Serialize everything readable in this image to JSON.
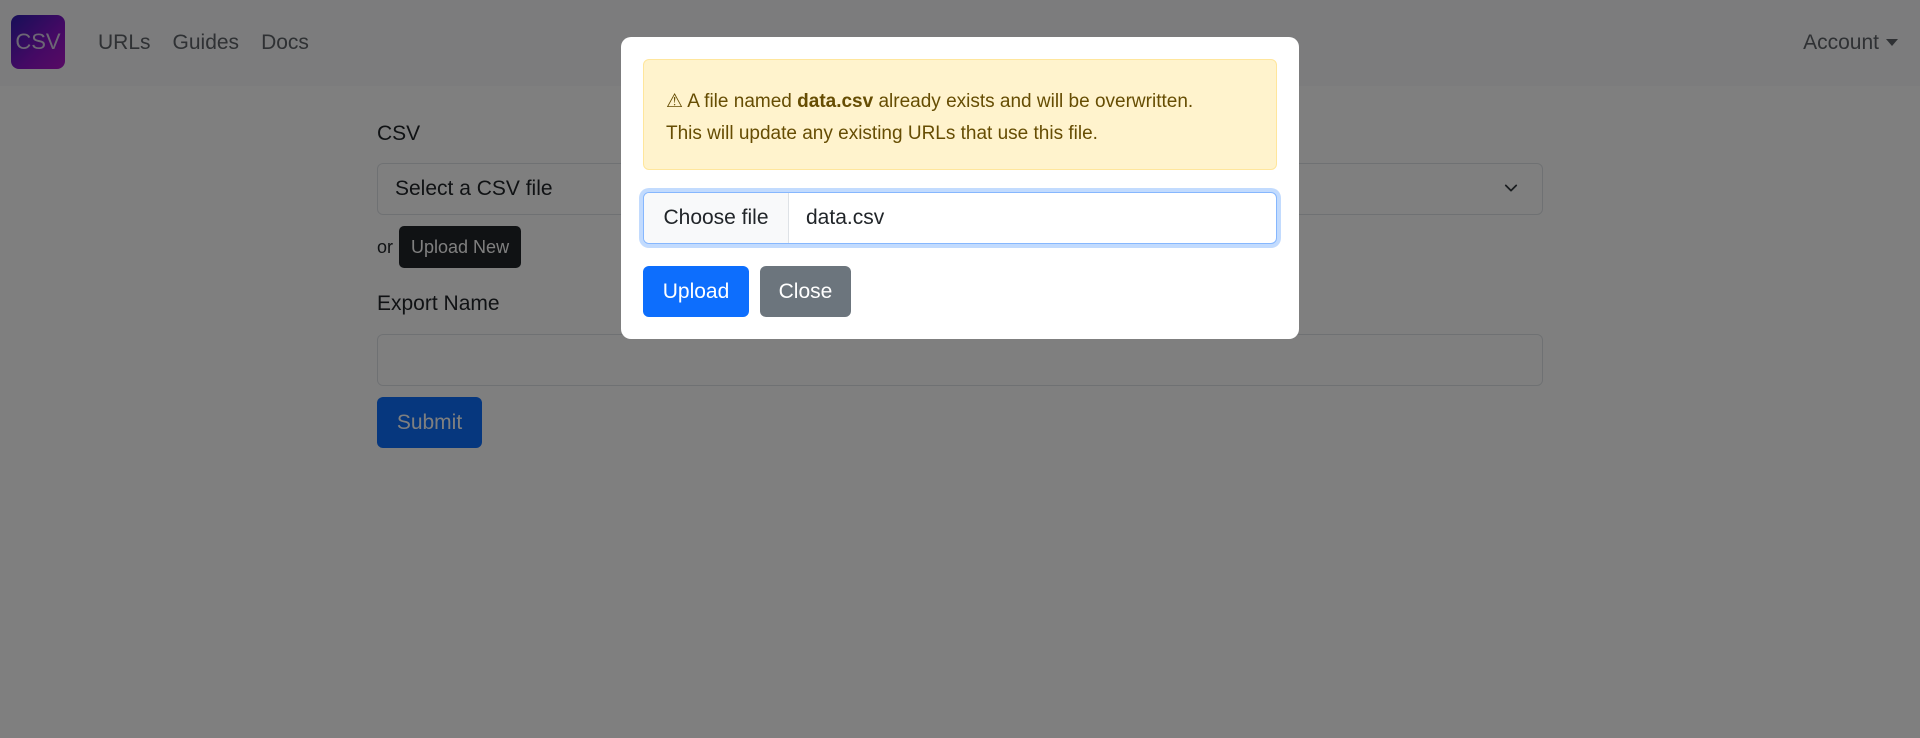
{
  "navbar": {
    "brand": "CSV",
    "links": [
      "URLs",
      "Guides",
      "Docs"
    ],
    "account": "Account"
  },
  "form": {
    "csv_label": "CSV",
    "select_value": "Select a CSV file",
    "or_text": "or",
    "upload_new_label": "Upload New",
    "export_label": "Export Name",
    "export_value": "",
    "submit_label": "Submit"
  },
  "modal": {
    "alert": {
      "icon": "⚠",
      "prefix": "A file named",
      "filename": "data.csv",
      "suffix": "already exists and will be overwritten.",
      "line2": "This will update any existing URLs that use this file."
    },
    "file_button_label": "Choose file",
    "file_name": "data.csv",
    "upload_label": "Upload",
    "close_label": "Close"
  },
  "colors": {
    "primary": "#0d6efd",
    "secondary": "#6c757d",
    "dark": "#212529",
    "warning_bg": "#fff3cd",
    "warning_text": "#664d03"
  }
}
